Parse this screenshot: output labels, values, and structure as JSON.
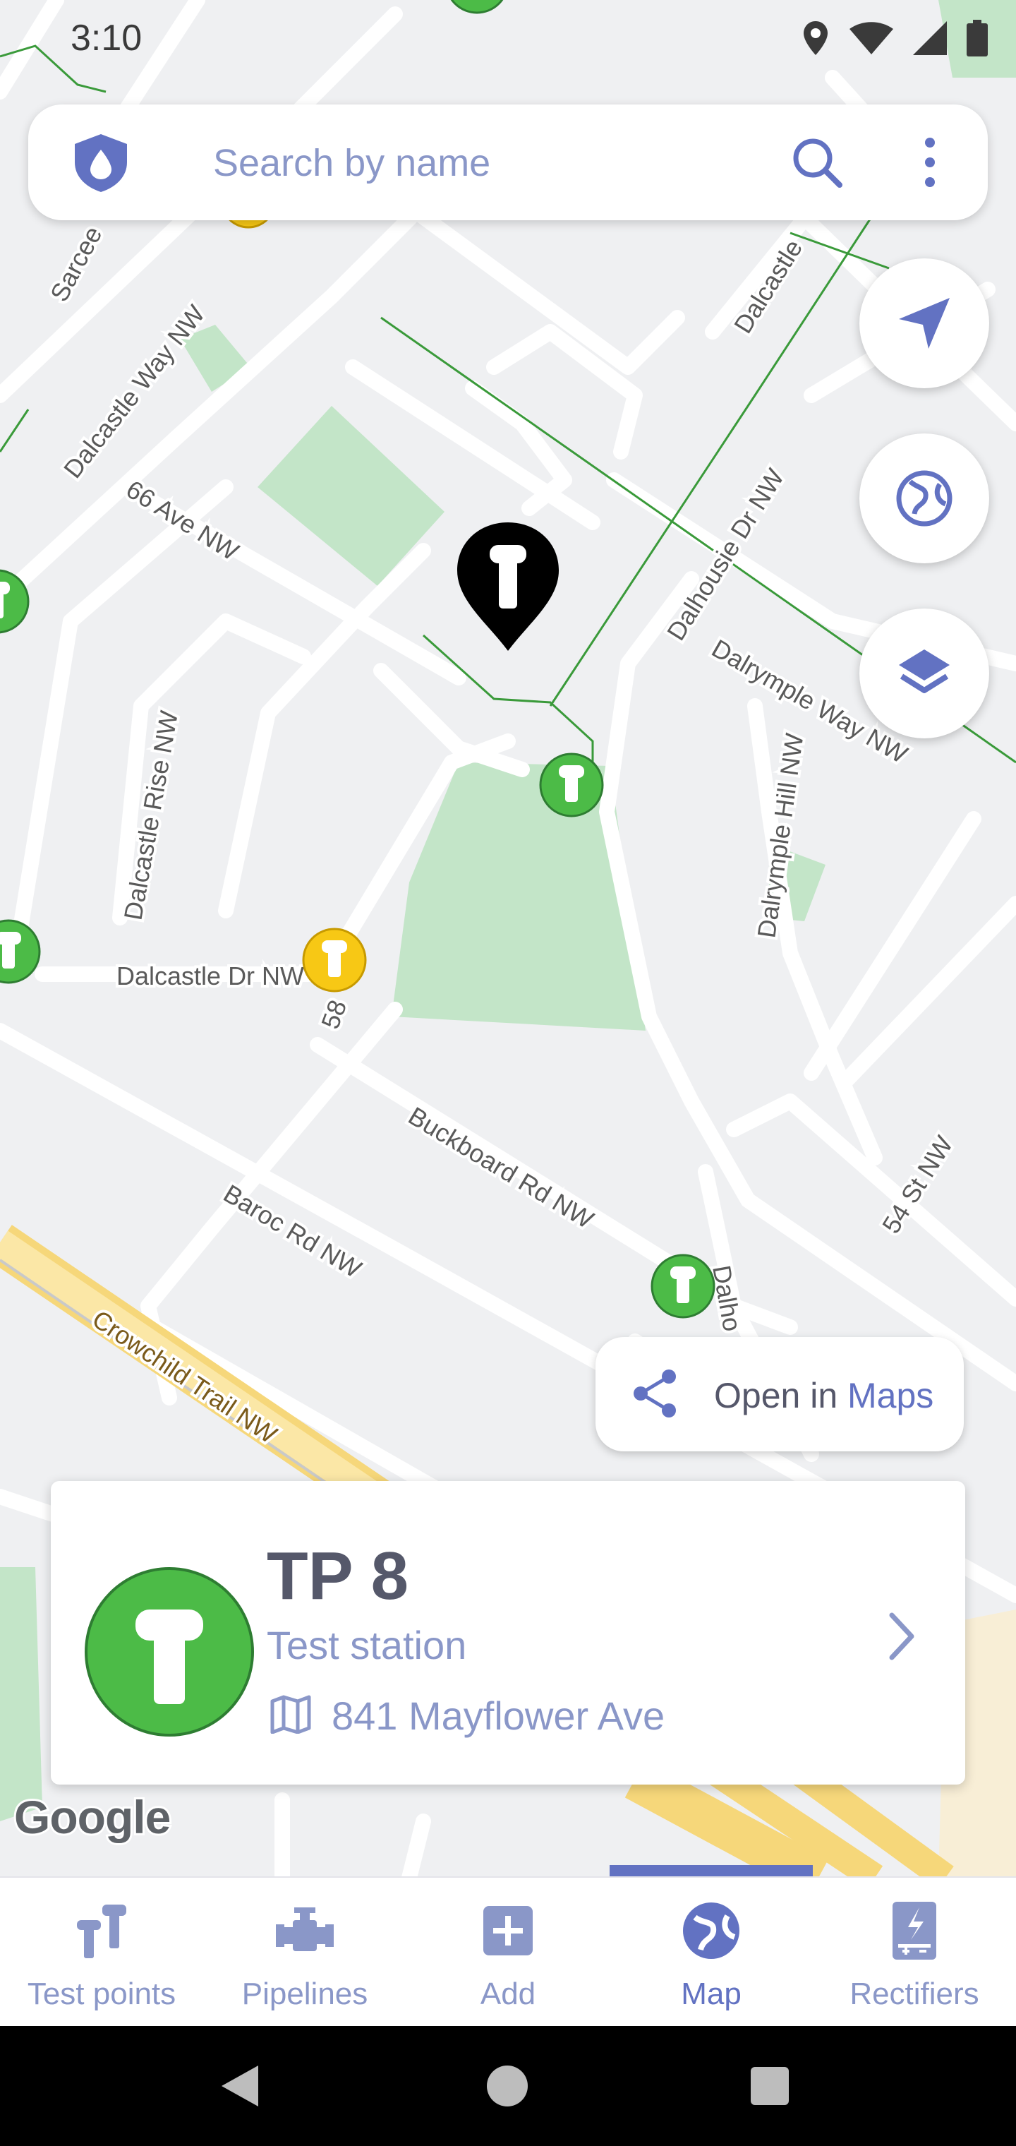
{
  "status_bar": {
    "time": "3:10"
  },
  "search": {
    "placeholder": "Search by name"
  },
  "map": {
    "streets": [
      "Sarcee",
      "Dalcastle Way NW",
      "66 Ave NW",
      "Dalhousie Dr NW",
      "Dalrymple Way NW",
      "Dalcastle Rise NW",
      "Dalrymple Hill NW",
      "Dalcastle Dr NW",
      "58",
      "Buckboard Rd NW",
      "Baroc Rd NW",
      "54 St NW",
      "Crowchild Trail NW",
      "Dalcastle",
      "Dalho"
    ],
    "attribution": "Google"
  },
  "open_in_maps": {
    "prefix": "Open in",
    "accent": "Maps"
  },
  "card": {
    "title": "TP 8",
    "subtitle": "Test station",
    "address": "841 Mayflower Ave"
  },
  "nav": {
    "items": [
      {
        "label": "Test points",
        "icon": "test-points-icon"
      },
      {
        "label": "Pipelines",
        "icon": "pipeline-icon"
      },
      {
        "label": "Add",
        "icon": "add-icon"
      },
      {
        "label": "Map",
        "icon": "globe-icon"
      },
      {
        "label": "Rectifiers",
        "icon": "rectifier-icon"
      }
    ],
    "active": "Map"
  },
  "colors": {
    "accent": "#6272c2",
    "marker_green": "#4cbb47",
    "marker_yellow": "#f7c815",
    "pipeline_line": "#3a9a3a",
    "park": "#c3e5c8"
  }
}
